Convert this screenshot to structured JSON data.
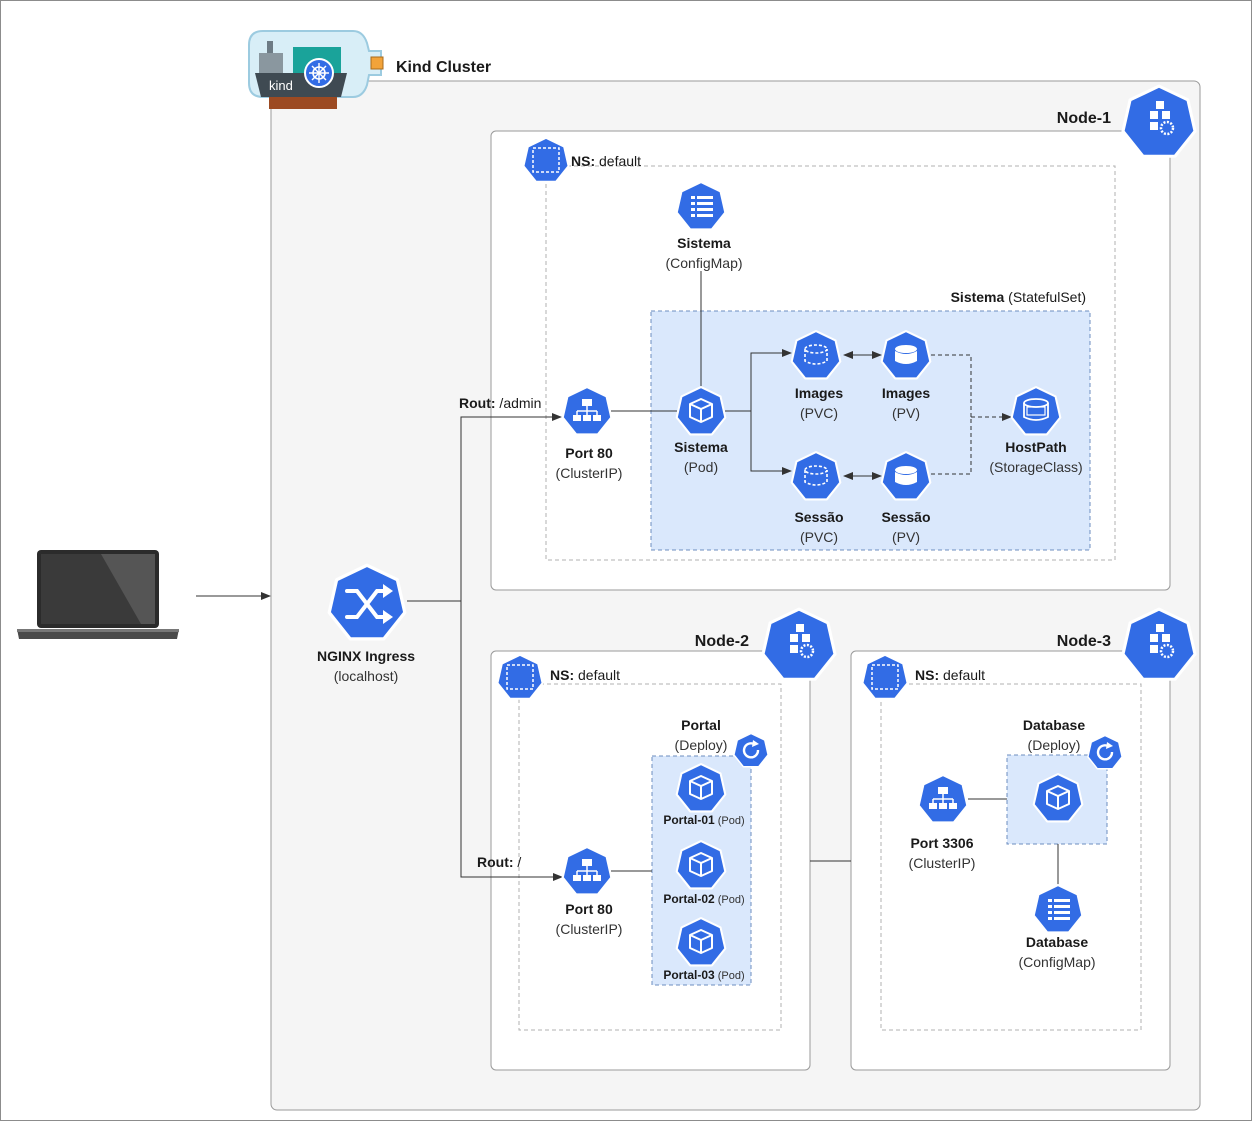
{
  "cluster": {
    "title": "Kind Cluster",
    "logo_text": "kind"
  },
  "client": {
    "icon": "laptop-icon"
  },
  "ingress": {
    "name": "NGINX Ingress",
    "sub": "(localhost)",
    "icon": "ingress-icon"
  },
  "routes": {
    "admin_key": "Rout:",
    "admin_val": " /admin",
    "root_key": "Rout:",
    "root_val": " /"
  },
  "node1": {
    "title": "Node-1",
    "ns_key": "NS:",
    "ns_val": " default",
    "configmap": {
      "name": "Sistema",
      "sub": "(ConfigMap)"
    },
    "statefulset_key": "Sistema",
    "statefulset_val": " (StatefulSet)",
    "service": {
      "name": "Port 80",
      "sub": "(ClusterIP)"
    },
    "pod": {
      "name": "Sistema",
      "sub": "(Pod)"
    },
    "images_pvc": {
      "name": "Images",
      "sub": "(PVC)"
    },
    "images_pv": {
      "name": "Images",
      "sub": "(PV)"
    },
    "sessao_pvc": {
      "name": "Sessão",
      "sub": "(PVC)"
    },
    "sessao_pv": {
      "name": "Sessão",
      "sub": "(PV)"
    },
    "hostpath": {
      "name": "HostPath",
      "sub": "(StorageClass)"
    }
  },
  "node2": {
    "title": "Node-2",
    "ns_key": "NS:",
    "ns_val": " default",
    "deploy": {
      "name": "Portal",
      "sub": "(Deploy)"
    },
    "service": {
      "name": "Port 80",
      "sub": "(ClusterIP)"
    },
    "pods": [
      {
        "name": "Portal-01",
        "sub": " (Pod)"
      },
      {
        "name": "Portal-02",
        "sub": " (Pod)"
      },
      {
        "name": "Portal-03",
        "sub": " (Pod)"
      }
    ]
  },
  "node3": {
    "title": "Node-3",
    "ns_key": "NS:",
    "ns_val": " default",
    "deploy": {
      "name": "Database",
      "sub": "(Deploy)"
    },
    "service": {
      "name": "Port 3306",
      "sub": "(ClusterIP)"
    },
    "configmap": {
      "name": "Database",
      "sub": "(ConfigMap)"
    }
  },
  "colors": {
    "k8s_blue": "#326ce5",
    "statefulset_fill": "#dae8fc",
    "cluster_fill": "#f5f5f5"
  }
}
